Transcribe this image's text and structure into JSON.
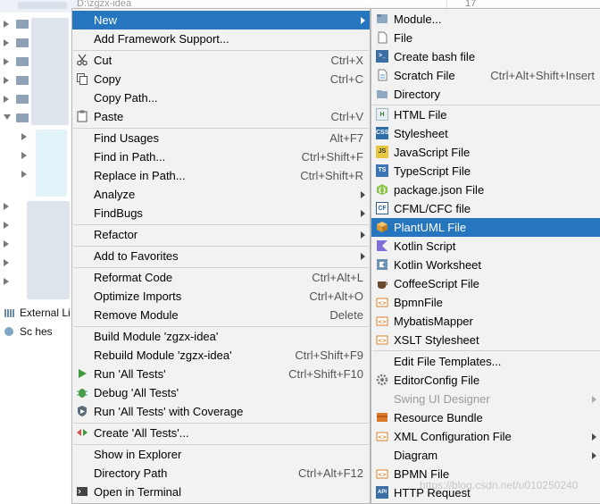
{
  "background": {
    "path_text": "D:\\zgzx-idea",
    "right_number": "17",
    "tree_labels": [
      "External Li",
      "Sc  hes"
    ]
  },
  "main_menu": [
    {
      "label": "New",
      "submenu": true,
      "highlighted": true
    },
    {
      "label": "Add Framework Support..."
    },
    {
      "label": "Cut",
      "shortcut": "Ctrl+X",
      "icon": "scissors-icon"
    },
    {
      "label": "Copy",
      "shortcut": "Ctrl+C",
      "icon": "copy-icon"
    },
    {
      "label": "Copy Path..."
    },
    {
      "label": "Paste",
      "shortcut": "Ctrl+V",
      "icon": "paste-icon"
    },
    {
      "label": "Find Usages",
      "shortcut": "Alt+F7"
    },
    {
      "label": "Find in Path...",
      "shortcut": "Ctrl+Shift+F"
    },
    {
      "label": "Replace in Path...",
      "shortcut": "Ctrl+Shift+R"
    },
    {
      "label": "Analyze",
      "submenu": true
    },
    {
      "label": "FindBugs",
      "submenu": true
    },
    {
      "label": "Refactor",
      "submenu": true
    },
    {
      "label": "Add to Favorites",
      "submenu": true
    },
    {
      "label": "Reformat Code",
      "shortcut": "Ctrl+Alt+L"
    },
    {
      "label": "Optimize Imports",
      "shortcut": "Ctrl+Alt+O"
    },
    {
      "label": "Remove Module",
      "shortcut": "Delete"
    },
    {
      "label": "Build Module 'zgzx-idea'"
    },
    {
      "label": "Rebuild Module 'zgzx-idea'",
      "shortcut": "Ctrl+Shift+F9"
    },
    {
      "label": "Run 'All Tests'",
      "shortcut": "Ctrl+Shift+F10",
      "icon": "run-icon"
    },
    {
      "label": "Debug 'All Tests'",
      "icon": "debug-icon"
    },
    {
      "label": "Run 'All Tests' with Coverage",
      "icon": "coverage-icon"
    },
    {
      "label": "Create 'All Tests'...",
      "icon": "create-test-icon"
    },
    {
      "label": "Show in Explorer"
    },
    {
      "label": "Directory Path",
      "shortcut": "Ctrl+Alt+F12"
    },
    {
      "label": "Open in Terminal",
      "icon": "terminal-icon"
    }
  ],
  "sub_menu": [
    {
      "label": "Module...",
      "icon": "module-icon"
    },
    {
      "label": "File",
      "icon": "file-icon"
    },
    {
      "label": "Create bash file",
      "icon": "bash-icon"
    },
    {
      "label": "Scratch File",
      "shortcut": "Ctrl+Alt+Shift+Insert",
      "icon": "scratch-icon"
    },
    {
      "label": "Directory",
      "icon": "folder-icon"
    },
    {
      "label": "HTML File",
      "icon": "html-icon"
    },
    {
      "label": "Stylesheet",
      "icon": "css-icon"
    },
    {
      "label": "JavaScript File",
      "icon": "js-icon"
    },
    {
      "label": "TypeScript File",
      "icon": "ts-icon"
    },
    {
      "label": "package.json File",
      "icon": "package-json-icon"
    },
    {
      "label": "CFML/CFC file",
      "icon": "cfml-icon"
    },
    {
      "label": "PlantUML File",
      "icon": "plantuml-icon",
      "highlighted": true
    },
    {
      "label": "Kotlin Script",
      "icon": "kotlin-icon"
    },
    {
      "label": "Kotlin Worksheet",
      "icon": "kotlin-worksheet-icon"
    },
    {
      "label": "CoffeeScript File",
      "icon": "coffee-icon"
    },
    {
      "label": "BpmnFile",
      "icon": "bpmn-icon"
    },
    {
      "label": "MybatisMapper",
      "icon": "mybatis-icon"
    },
    {
      "label": "XSLT Stylesheet",
      "icon": "xslt-icon"
    },
    {
      "label": "Edit File Templates..."
    },
    {
      "label": "EditorConfig File",
      "icon": "gear-icon"
    },
    {
      "label": "Swing UI Designer",
      "submenu": true,
      "disabled": true
    },
    {
      "label": "Resource Bundle",
      "icon": "resource-bundle-icon"
    },
    {
      "label": "XML Configuration File",
      "submenu": true,
      "icon": "xml-icon"
    },
    {
      "label": "Diagram",
      "submenu": true
    },
    {
      "label": "BPMN File",
      "icon": "bpmn-file-icon"
    },
    {
      "label": "HTTP Request",
      "icon": "api-icon"
    }
  ],
  "watermark": "https://blog.csdn.net/u010250240",
  "colors": {
    "highlight": "#2675bf",
    "menu_bg": "#f2f2f2"
  }
}
